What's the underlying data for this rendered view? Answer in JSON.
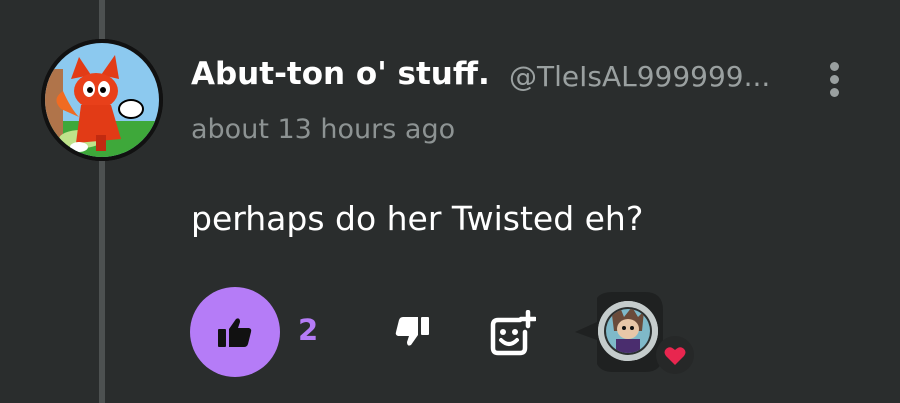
{
  "comment": {
    "author_name": "Abut-ton o' stuff.",
    "author_handle": "@TleIsAL999999...",
    "timestamp": "about 13 hours ago",
    "text": "perhaps do her Twisted eh?"
  },
  "actions": {
    "like_count": "2"
  },
  "icons": {
    "like": "thumbs-up-icon",
    "dislike": "thumbs-down-icon",
    "react": "add-reaction-icon",
    "more": "more-vertical-icon",
    "reaction": "heart-icon"
  },
  "colors": {
    "background": "#2a2d2d",
    "accent": "#b57cf7",
    "heart": "#e8264f",
    "text_primary": "#ffffff",
    "text_secondary": "#8d9393"
  }
}
